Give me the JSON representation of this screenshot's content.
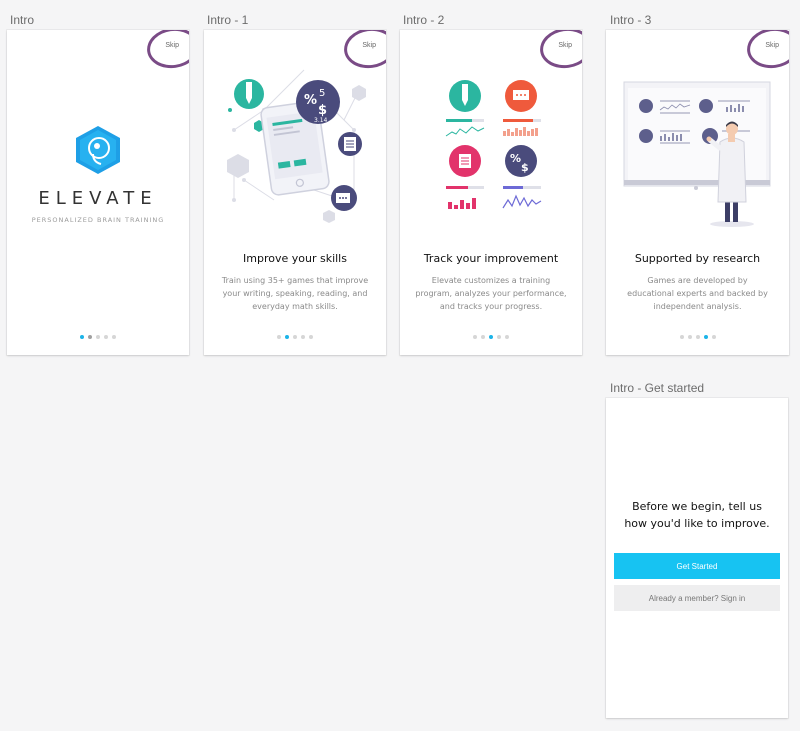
{
  "screens": [
    {
      "label": "Intro",
      "skip": "Skip",
      "logo_word": "ELEVATE",
      "logo_tagline": "PERSONALIZED BRAIN TRAINING",
      "active_dot": 0
    },
    {
      "label": "Intro - 1",
      "skip": "Skip",
      "title": "Improve your skills",
      "body": [
        "Train using 35+ games that improve",
        "your writing, speaking, reading, and",
        "everyday math skills."
      ],
      "active_dot": 1
    },
    {
      "label": "Intro - 2",
      "skip": "Skip",
      "title": "Track your improvement",
      "body": [
        "Elevate customizes a training",
        "program, analyzes your performance,",
        "and tracks your progress."
      ],
      "active_dot": 2
    },
    {
      "label": "Intro - 3",
      "skip": "Skip",
      "title": "Supported by research",
      "body": [
        "Games are developed by",
        "educational experts and backed by",
        "independent analysis."
      ],
      "active_dot": 3
    }
  ],
  "get_started": {
    "label": "Intro - Get started",
    "title_line1": "Before we begin, tell us",
    "title_line2": "how you'd like to improve.",
    "primary_button": "Get Started",
    "secondary_button": "Already a member? Sign in"
  },
  "illustration_text": {
    "percent": "%",
    "dollar": "$",
    "five": "5",
    "pi": "3.14"
  },
  "colors": {
    "accent": "#17c3f2",
    "annotation": "#7a4b86",
    "teal": "#2bb6a0",
    "coral": "#ef5a3c",
    "magenta": "#e2336b",
    "navy": "#4a4b7c",
    "purple": "#6d6ad6"
  }
}
